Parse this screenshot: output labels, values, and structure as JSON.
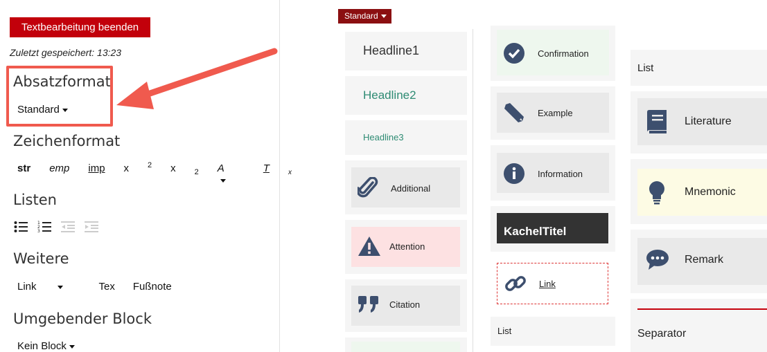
{
  "left": {
    "end_button": "Textbearbeitung beenden",
    "saved": "Zuletzt gespeichert: 13:23",
    "absatz_title": "Absatzformat",
    "absatz_value": "Standard",
    "zeichen_title": "Zeichenformat",
    "zeichen": {
      "str": "str",
      "emp": "emp",
      "imp": "imp",
      "sup_base": "x",
      "sup": "2",
      "sub_base": "x",
      "sub": "2",
      "font": "A",
      "clear": "T",
      "clear_sub": "x"
    },
    "listen_title": "Listen",
    "weitere_title": "Weitere",
    "weitere": {
      "link": "Link",
      "tex": "Tex",
      "fussnote": "Fußnote"
    },
    "block_title": "Umgebender Block",
    "block_value": "Kein Block"
  },
  "right": {
    "standard_dropdown": "Standard",
    "col1": {
      "headline1": "Headline1",
      "headline2": "Headline2",
      "headline3": "Headline3",
      "additional": "Additional",
      "attention": "Attention",
      "citation": "Citation"
    },
    "col2": {
      "confirmation": "Confirmation",
      "example": "Example",
      "information": "Information",
      "kacheltitel": "KachelTitel",
      "link": "Link",
      "list": "List"
    },
    "col3": {
      "list": "List",
      "literature": "Literature",
      "mnemonic": "Mnemonic",
      "remark": "Remark",
      "separator": "Separator"
    }
  },
  "colors": {
    "end_button": "#c2000b",
    "highlight": "#f05a4e",
    "icon": "#3d4f6e",
    "teal_text": "#2e8b73",
    "attention_bg": "#fde1e2",
    "confirmation_bg": "#eef7ee",
    "mnemonic_bg": "#fdfbe4"
  }
}
